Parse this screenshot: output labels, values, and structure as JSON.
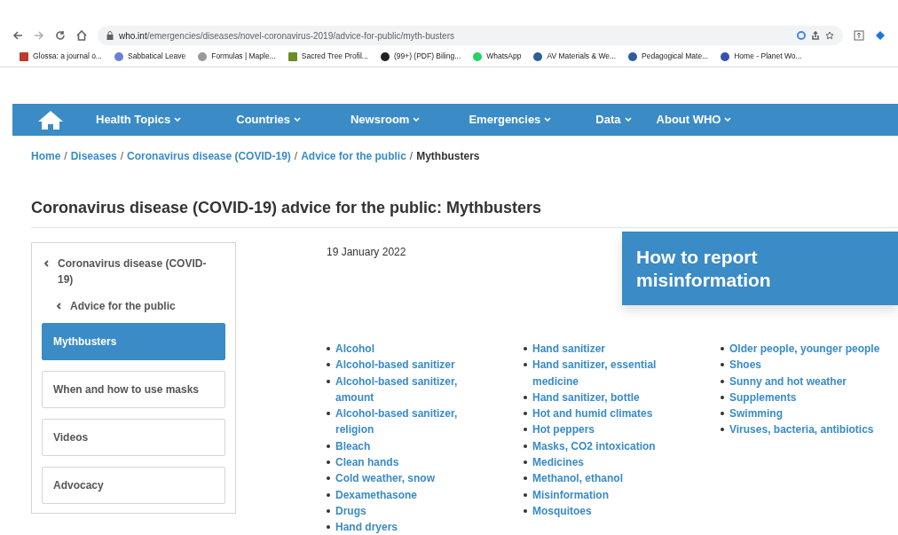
{
  "browser": {
    "url_host": "who.int",
    "url_path": "/emergencies/diseases/novel-coronavirus-2019/advice-for-public/myth-busters",
    "bookmarks": [
      "Glossa: a journal o...",
      "Sabbatical Leave",
      "Formulas | Maple...",
      "Sacred Tree Profil...",
      "(99+) (PDF) Biling...",
      "WhatsApp",
      "AV Materials & We...",
      "Pedagogical Mate...",
      "Home - Planet Wo..."
    ]
  },
  "nav": {
    "items": [
      "Health Topics",
      "Countries",
      "Newsroom",
      "Emergencies",
      "Data",
      "About WHO"
    ]
  },
  "breadcrumb": [
    {
      "label": "Home",
      "link": true
    },
    {
      "separator": "/",
      "label": "Diseases",
      "link": true
    },
    {
      "separator": "/",
      "label": "Coronavirus disease (COVID-19)",
      "link": true
    },
    {
      "separator": "/",
      "label": "Advice for the public",
      "link": true
    },
    {
      "separator": "/",
      "label": "Mythbusters",
      "link": false
    }
  ],
  "page_title": "Coronavirus disease (COVID-19) advice for the public: Mythbusters",
  "sidebar": {
    "back_links": [
      "Coronavirus disease (COVID-19)",
      "Advice for the public"
    ],
    "items": [
      {
        "label": "Mythbusters",
        "selected": true
      },
      {
        "label": "When and how to use masks",
        "selected": false
      },
      {
        "label": "Videos",
        "selected": false
      },
      {
        "label": "Advocacy",
        "selected": false
      }
    ]
  },
  "date": "19 January 2022",
  "report_box": "How to report misinformation",
  "topic_columns": [
    [
      "Alcohol",
      "Alcohol-based sanitizer",
      "Alcohol-based sanitizer, amount",
      "Alcohol-based sanitizer, religion",
      "Bleach",
      "Clean hands",
      "Cold weather, snow",
      "Dexamethasone",
      "Drugs",
      "Hand dryers"
    ],
    [
      "Hand sanitizer",
      "Hand sanitizer, essential medicine",
      "Hand sanitizer, bottle",
      "Hot and humid climates",
      "Hot peppers",
      "Masks, CO2 intoxication",
      "Medicines",
      "Methanol, ethanol",
      "Misinformation",
      "Mosquitoes"
    ],
    [
      "Older people, younger people",
      "Shoes",
      "Sunny and hot weather",
      "Supplements",
      "Swimming",
      "Viruses, bacteria, antibiotics"
    ]
  ]
}
